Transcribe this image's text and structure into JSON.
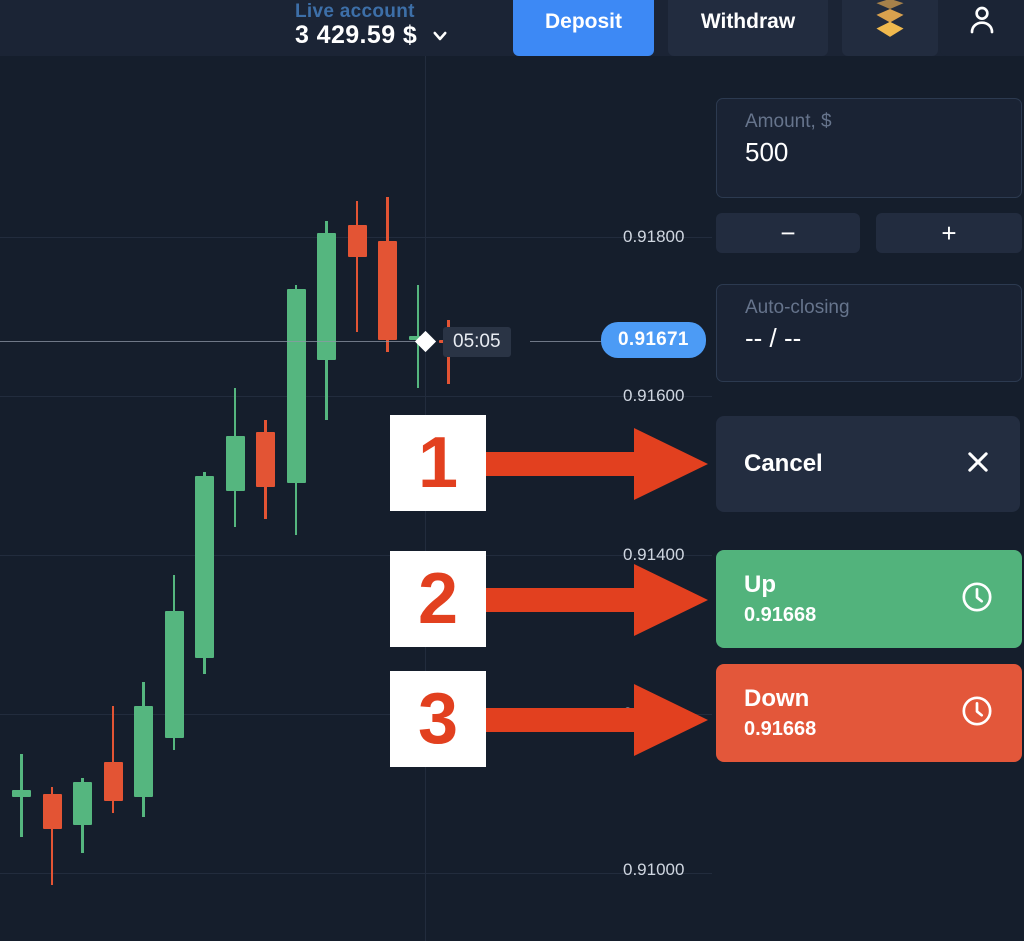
{
  "header": {
    "account_type": "Live account",
    "balance": "3 429.59 $",
    "caret_icon": "chevron-down-icon",
    "deposit_label": "Deposit",
    "withdraw_label": "Withdraw",
    "rank_icon": "gold-chevron-rank-icon",
    "profile_icon": "person-icon"
  },
  "panel": {
    "amount": {
      "label": "Amount, $",
      "value": "500"
    },
    "minus_label": "−",
    "plus_label": "+",
    "auto_closing": {
      "label": "Auto-closing",
      "value": "-- / --"
    },
    "cancel": {
      "label": "Cancel",
      "icon": "close-icon"
    },
    "up": {
      "label": "Up",
      "price": "0.91668",
      "icon": "clock-icon",
      "color": "#52b37c"
    },
    "down": {
      "label": "Down",
      "price": "0.91668",
      "icon": "clock-icon",
      "color": "#e3573a"
    }
  },
  "chart": {
    "current_price": "0.91671",
    "timer": "05:05",
    "accent_blue": "#4c9bf5",
    "bg": "#151e2c",
    "up_color": "#55b67f",
    "down_color": "#e35434"
  },
  "annotations": {
    "one": "1",
    "two": "2",
    "three": "3",
    "color": "#e2401f"
  },
  "chart_data": {
    "type": "candlestick",
    "title": "",
    "xlabel": "",
    "ylabel": "",
    "grid": true,
    "ylim": [
      0.9092,
      0.9188
    ],
    "y_ticks": [
      "0.91800",
      "0.91600",
      "0.91400",
      "0.91200",
      "0.91000"
    ],
    "y_tick_values": [
      0.918,
      0.916,
      0.914,
      0.912,
      0.91
    ],
    "current_price": 0.91671,
    "price_line": 0.91671,
    "candles": [
      {
        "i": 1,
        "open": 0.91095,
        "close": 0.91105,
        "high": 0.9115,
        "low": 0.91045,
        "dir": "up"
      },
      {
        "i": 2,
        "open": 0.911,
        "close": 0.91055,
        "high": 0.91108,
        "low": 0.90985,
        "dir": "down"
      },
      {
        "i": 3,
        "open": 0.9106,
        "close": 0.91115,
        "high": 0.9112,
        "low": 0.91025,
        "dir": "up"
      },
      {
        "i": 4,
        "open": 0.9114,
        "close": 0.9109,
        "high": 0.9121,
        "low": 0.91075,
        "dir": "down"
      },
      {
        "i": 5,
        "open": 0.91095,
        "close": 0.9121,
        "high": 0.9124,
        "low": 0.9107,
        "dir": "up"
      },
      {
        "i": 6,
        "open": 0.9117,
        "close": 0.9133,
        "high": 0.91375,
        "low": 0.91155,
        "dir": "up"
      },
      {
        "i": 7,
        "open": 0.9127,
        "close": 0.915,
        "high": 0.91505,
        "low": 0.9125,
        "dir": "up"
      },
      {
        "i": 8,
        "open": 0.9148,
        "close": 0.9155,
        "high": 0.9161,
        "low": 0.91435,
        "dir": "up"
      },
      {
        "i": 9,
        "open": 0.91555,
        "close": 0.91485,
        "high": 0.9157,
        "low": 0.91445,
        "dir": "down"
      },
      {
        "i": 10,
        "open": 0.9149,
        "close": 0.91735,
        "high": 0.9174,
        "low": 0.91425,
        "dir": "up"
      },
      {
        "i": 11,
        "open": 0.91645,
        "close": 0.91805,
        "high": 0.9182,
        "low": 0.9157,
        "dir": "up"
      },
      {
        "i": 12,
        "open": 0.91815,
        "close": 0.91775,
        "high": 0.91845,
        "low": 0.9168,
        "dir": "down"
      },
      {
        "i": 13,
        "open": 0.91795,
        "close": 0.9167,
        "high": 0.9185,
        "low": 0.91655,
        "dir": "down"
      },
      {
        "i": 14,
        "open": 0.91675,
        "close": 0.9167,
        "high": 0.9174,
        "low": 0.9161,
        "dir": "up"
      },
      {
        "i": 15,
        "open": 0.91671,
        "close": 0.91671,
        "high": 0.91695,
        "low": 0.91615,
        "dir": "down"
      }
    ]
  }
}
